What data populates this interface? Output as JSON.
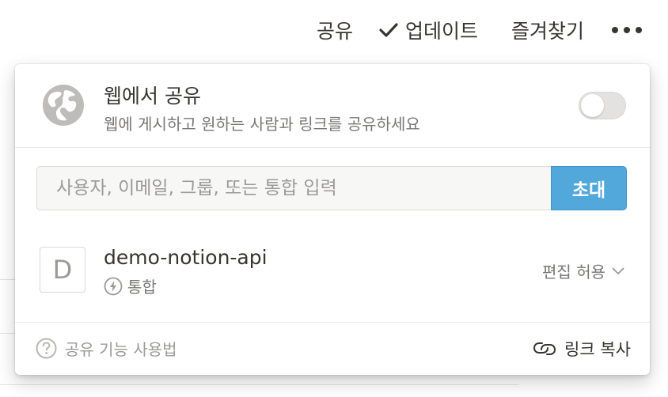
{
  "topbar": {
    "share_label": "공유",
    "updates_label": "업데이트",
    "favorites_label": "즐겨찾기",
    "more_label": "•••"
  },
  "web_share": {
    "title": "웹에서 공유",
    "description": "웹에 게시하고 원하는 사람과 링크를 공유하세요",
    "enabled": false
  },
  "invite": {
    "placeholder": "사용자, 이메일, 그룹, 또는 통합 입력",
    "button_label": "초대"
  },
  "members": [
    {
      "avatar_letter": "D",
      "name": "demo-notion-api",
      "type": "통합",
      "permission": "편집 허용"
    }
  ],
  "footer": {
    "help_label": "공유 기능 사용법",
    "copy_link_label": "링크 복사"
  },
  "colors": {
    "accent": "#52a8db",
    "text": "#37352f",
    "muted": "#787774"
  }
}
